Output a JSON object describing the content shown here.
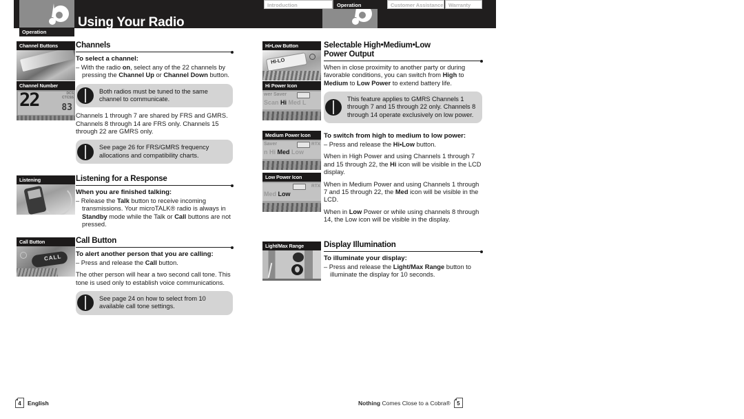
{
  "header": {
    "title": "Using Your Radio",
    "logo_icon": "cobra-logo-icon",
    "left_tab_label": "Operation",
    "tabs": [
      {
        "label": "Introduction",
        "active": false
      },
      {
        "label": "Operation",
        "active": true
      },
      {
        "label": "Customer Assistance",
        "active": false
      },
      {
        "label": "Warranty",
        "active": false
      }
    ]
  },
  "left_page": {
    "sections": [
      {
        "heading": "Channels",
        "subheading": "To select a channel:",
        "thumbs": [
          {
            "caption": "Channel Buttons",
            "style": "ph1"
          },
          {
            "caption": "Channel Number",
            "style": "lcd",
            "lcd_big": "22",
            "lcd_small": "83",
            "lcd_tiny": "DCS\nCTCSS"
          }
        ],
        "bullet": "– With the radio on, select any of the 22 channels by pressing the Channel Up or Channel Down button.",
        "note1": "Both radios must be tuned to the same channel to communicate.",
        "body": "Channels 1 through 7 are shared by FRS and GMRS. Channels 8 through 14 are FRS only. Channels 15 through 22 are GMRS only.",
        "note2": "See page 26 for FRS/GMRS frequency allocations and compatibility charts."
      },
      {
        "heading": "Listening for a Response",
        "subheading": "When you are finished talking:",
        "thumbs": [
          {
            "caption": "Listening",
            "style": "radio"
          }
        ],
        "bullet": "– Release the Talk button to receive incoming transmissions. Your microTALK® radio is always in Standby mode while the Talk or Call buttons are not pressed."
      },
      {
        "heading": "Call Button",
        "subheading": "To alert another person that you are calling:",
        "thumbs": [
          {
            "caption": "Call Button",
            "style": "call"
          }
        ],
        "bullet": "– Press and release the Call button.",
        "body": "The other person will hear a two second call tone. This tone is used only to establish voice communications.",
        "note1": "See page 24 on how to select from 10 available call tone settings."
      }
    ]
  },
  "right_page": {
    "sections": [
      {
        "heading_line1": "Selectable High•Medium•Low",
        "heading_line2": "Power Output",
        "thumbs": [
          {
            "caption": "Hi•Low Button",
            "style": "hilo",
            "key_label": "HI-LO"
          },
          {
            "caption": "Hi Power Icon",
            "style": "icon",
            "row1": "wer Saver",
            "row2_pre": "Scan ",
            "row2_bold": "Hi",
            "row2_post": " Med L"
          }
        ],
        "body": "When in close proximity to another party or during favorable conditions, you can switch from High to Medium to Low Power to extend battery life.",
        "note1": "This feature applies to GMRS Channels 1 through 7 and 15 through 22 only. Channels 8 through 14 operate exclusively on low power."
      },
      {
        "subheading": "To switch from high to medium to low power:",
        "thumbs": [
          {
            "caption": "Medium Power Icon",
            "style": "icon",
            "row1": "Saver",
            "row2_pre": "n Hi ",
            "row2_bold": "Med",
            "row2_post": " Low",
            "rtx": "RTX"
          },
          {
            "caption": "Low Power Icon",
            "style": "icon",
            "row1": "",
            "row2_pre": "Med ",
            "row2_bold": "Low",
            "row2_post": "",
            "rtx": "RTX"
          }
        ],
        "bullet": "– Press and release the Hi•Low button.",
        "para1": "When in High Power and using Channels 1 through 7 and 15 through 22, the Hi icon will be visible in the LCD display.",
        "para2": "When in Medium Power and using Channels 1 through 7 and 15 through 22, the Med icon will be visible in the LCD.",
        "para3": "When in Low Power or while using channels 8 through 14, the Low icon will be visible in the display."
      },
      {
        "heading": "Display Illumination",
        "subheading": "To illuminate your display:",
        "thumbs": [
          {
            "caption": "Light/Max Range",
            "style": "light"
          }
        ],
        "bullet": "– Press and release the Light/Max Range button to illuminate the display for 10 seconds."
      }
    ]
  },
  "footer": {
    "left_page_number": "4",
    "left_label": "English",
    "right_tagline_bold": "Nothing",
    "right_tagline_rest": " Comes Close to a Cobra®",
    "right_page_number": "5"
  }
}
